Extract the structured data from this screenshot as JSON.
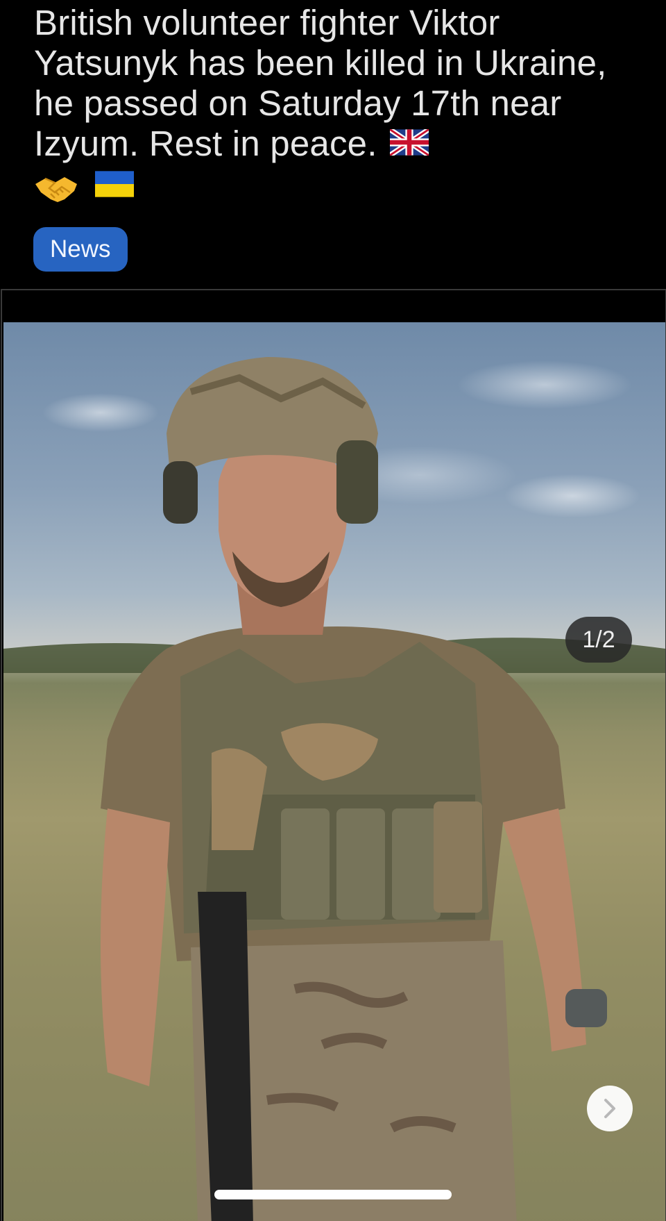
{
  "post": {
    "title": "British volunteer fighter Viktor Yatsunyk has been killed in Ukraine, he passed on Saturday 17th near Izyum. Rest in peace.",
    "flair": "News",
    "flair_color": "#2764c1"
  },
  "emojis": [
    "flag-united-kingdom-icon",
    "handshake-icon",
    "flag-ukraine-icon"
  ],
  "gallery": {
    "counter": "1/2",
    "current": 1,
    "total": 2
  },
  "colors": {
    "background": "#000000",
    "text": "#e6e6e6"
  }
}
